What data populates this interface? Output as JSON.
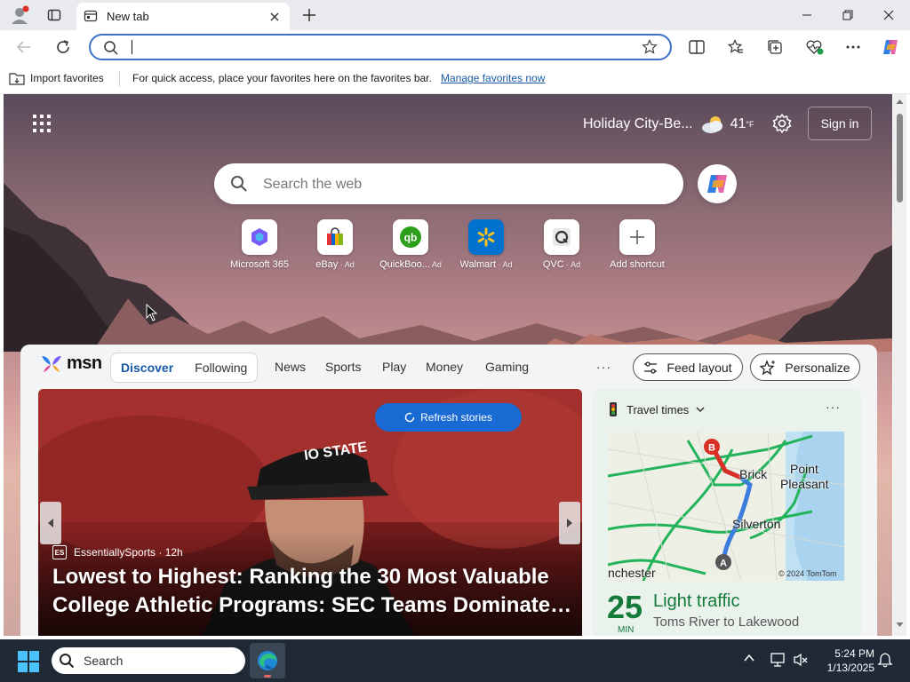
{
  "browser": {
    "tab_title": "New tab",
    "address_value": "",
    "favbar": {
      "import_label": "Import favorites",
      "hint": "For quick access, place your favorites here on the favorites bar.",
      "manage_link": "Manage favorites now"
    }
  },
  "ntp": {
    "weather": {
      "location": "Holiday City-Be...",
      "temp": "41",
      "unit": "°F"
    },
    "sign_in": "Sign in",
    "search_placeholder": "Search the web",
    "shortcuts": [
      {
        "label": "Microsoft 365",
        "ad": ""
      },
      {
        "label": "eBay",
        "ad": " · Ad"
      },
      {
        "label": "QuickBoo...",
        "ad": " Ad"
      },
      {
        "label": "Walmart",
        "ad": " · Ad"
      },
      {
        "label": "QVC",
        "ad": " · Ad"
      },
      {
        "label": "Add shortcut",
        "ad": ""
      }
    ]
  },
  "feed": {
    "brand": "msn",
    "tabs": [
      "Discover",
      "Following"
    ],
    "nav": [
      "News",
      "Sports",
      "Play",
      "Money",
      "Gaming"
    ],
    "more": "···",
    "feed_layout": "Feed layout",
    "personalize": "Personalize",
    "refresh": "Refresh stories",
    "hero": {
      "source_logo": "ES",
      "source": "EssentiallySports · 12h",
      "title_line1": "Lowest to Highest: Ranking the 30 Most Valuable",
      "title_line2": "College Athletic Programs: SEC Teams Dominate To...",
      "cap_text": "IO STATE"
    },
    "travel": {
      "title": "Travel times",
      "more": "···",
      "map_labels": {
        "b": "B",
        "a": "A",
        "brick": "Brick",
        "point": "Point",
        "pleasant": "Pleasant",
        "silverton": "Silverton",
        "west": "nchester"
      },
      "copyright": "© 2024 TomTom",
      "minutes": "25",
      "min_label": "MIN",
      "status": "Light traffic",
      "route": "Toms River to Lakewood"
    }
  },
  "taskbar": {
    "search": "Search",
    "time": "5:24 PM",
    "date": "1/13/2025"
  },
  "colors": {
    "accent": "#1a5aa8",
    "refresh_button": "#1a6ad3",
    "traffic_green": "#147a3a",
    "taskbar": "#1f2a36"
  }
}
